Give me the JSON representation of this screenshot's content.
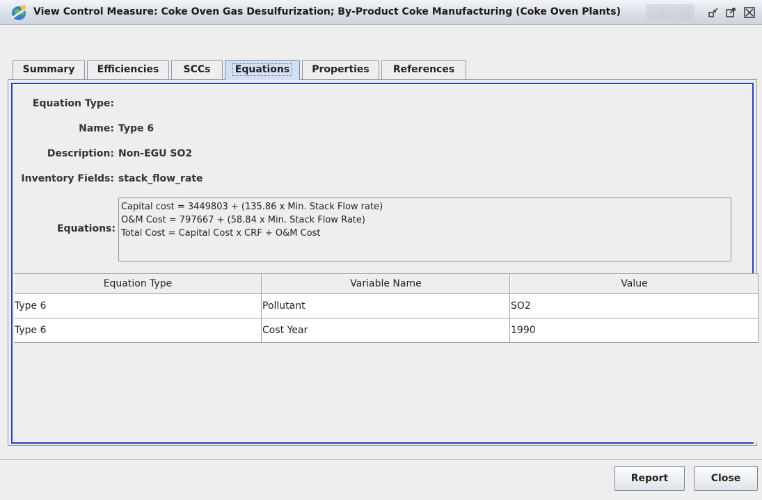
{
  "window": {
    "title": "View Control Measure: Coke Oven Gas Desulfurization; By-Product Coke Manufacturing (Coke Oven Plants)",
    "icon": "app-globe-icon"
  },
  "tabs": [
    {
      "label": "Summary"
    },
    {
      "label": "Efficiencies"
    },
    {
      "label": "SCCs"
    },
    {
      "label": "Equations",
      "active": true
    },
    {
      "label": "Properties"
    },
    {
      "label": "References"
    }
  ],
  "form": {
    "equation_type_label": "Equation Type:",
    "equation_type_value": "",
    "name_label": "Name:",
    "name_value": "Type 6",
    "description_label": "Description:",
    "description_value": "Non-EGU SO2",
    "inventory_label": "Inventory Fields:",
    "inventory_value": "stack_flow_rate",
    "equations_label": "Equations:",
    "equations_lines": [
      "Capital cost = 3449803 + (135.86 x Min. Stack Flow rate)",
      "O&M Cost = 797667 + (58.84 x Min. Stack Flow Rate)",
      "Total Cost = Capital Cost x CRF + O&M Cost"
    ]
  },
  "table": {
    "headers": [
      "Equation Type",
      "Variable Name",
      "Value"
    ],
    "rows": [
      [
        "Type 6",
        "Pollutant",
        "SO2"
      ],
      [
        "Type 6",
        "Cost Year",
        "1990"
      ]
    ]
  },
  "buttons": {
    "report": "Report",
    "close": "Close"
  }
}
